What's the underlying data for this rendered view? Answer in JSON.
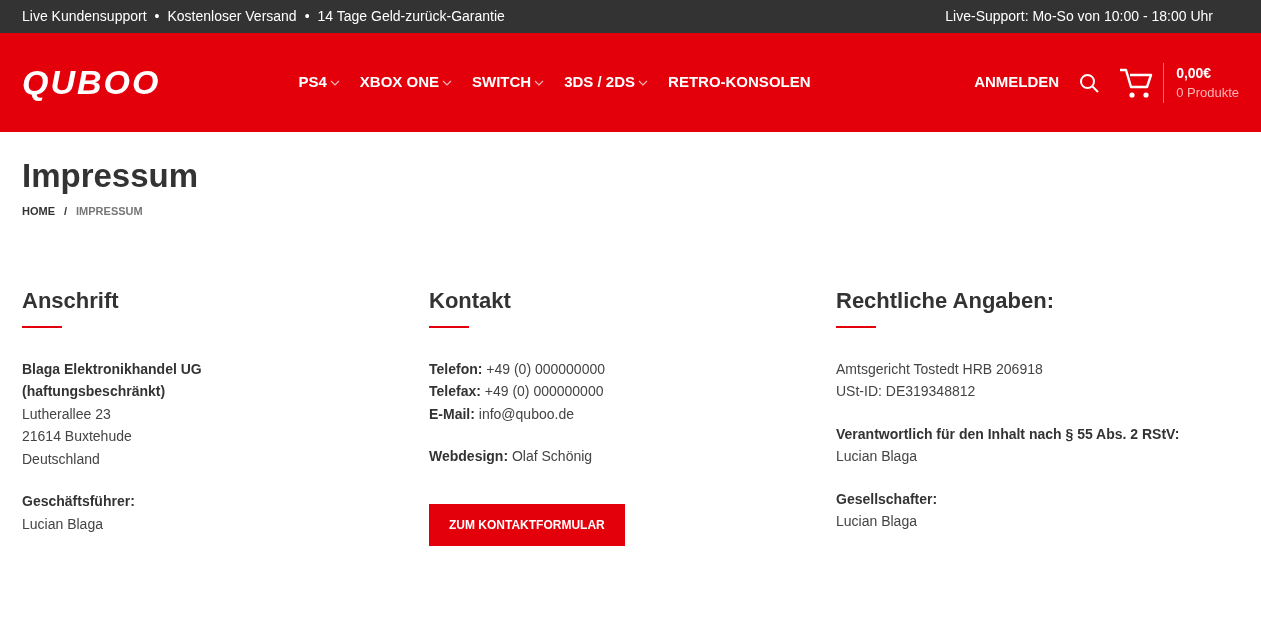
{
  "top_bar": {
    "features": [
      "Live Kundensupport",
      "Kostenloser Versand",
      "14 Tage Geld-zurück-Garantie"
    ],
    "separator": "•",
    "hours": "Live-Support: Mo-So von 10:00 - 18:00 Uhr"
  },
  "header": {
    "logo": "QUBOO",
    "nav": [
      {
        "label": "PS4",
        "dropdown": true
      },
      {
        "label": "XBOX ONE",
        "dropdown": true
      },
      {
        "label": "SWITCH",
        "dropdown": true
      },
      {
        "label": "3DS / 2DS",
        "dropdown": true
      },
      {
        "label": "RETRO-KONSOLEN",
        "dropdown": false
      }
    ],
    "login": "ANMELDEN",
    "cart": {
      "total": "0,00€",
      "count": "0 Produkte"
    }
  },
  "page": {
    "title": "Impressum",
    "breadcrumb": [
      {
        "label": "HOME",
        "selected": false
      },
      {
        "label": "IMPRESSUM",
        "selected": true
      }
    ],
    "breadcrumb_separator": "/"
  },
  "columns": [
    {
      "heading": "Anschrift",
      "groups": [
        [
          {
            "kind": "strong",
            "text": "Blaga Elektronikhandel UG"
          },
          {
            "kind": "strong",
            "text": "(haftungsbeschränkt)"
          },
          {
            "kind": "plain",
            "text": "Lutherallee 23"
          },
          {
            "kind": "plain",
            "text": "21614 Buxtehude"
          },
          {
            "kind": "plain",
            "text": "Deutschland"
          }
        ],
        [
          {
            "kind": "strong",
            "text": "Geschäftsführer:"
          },
          {
            "kind": "plain",
            "text": "Lucian Blaga"
          }
        ]
      ]
    },
    {
      "heading": "Kontakt",
      "groups": [
        [
          {
            "kind": "rich",
            "text": "**Telefon:** +49 (0) 000000000"
          },
          {
            "kind": "rich",
            "text": "**Telefax:** +49 (0) 000000000"
          },
          {
            "kind": "rich",
            "text": "**E-Mail:** info@quboo.de"
          }
        ],
        [
          {
            "kind": "rich",
            "text": "**Webdesign:** Olaf Schönig"
          }
        ]
      ],
      "button": "ZUM KONTAKTFORMULAR"
    },
    {
      "heading": "Rechtliche Angaben:",
      "groups": [
        [
          {
            "kind": "plain",
            "text": "Amtsgericht Tostedt HRB 206918"
          },
          {
            "kind": "plain",
            "text": "USt-ID: DE319348812"
          }
        ],
        [
          {
            "kind": "strong",
            "text": "Verantwortlich für den Inhalt nach § 55 Abs. 2 RStV:"
          },
          {
            "kind": "plain",
            "text": "Lucian Blaga"
          }
        ],
        [
          {
            "kind": "strong",
            "text": "Gesellschafter:"
          },
          {
            "kind": "plain",
            "text": "Lucian Blaga"
          }
        ]
      ]
    }
  ]
}
